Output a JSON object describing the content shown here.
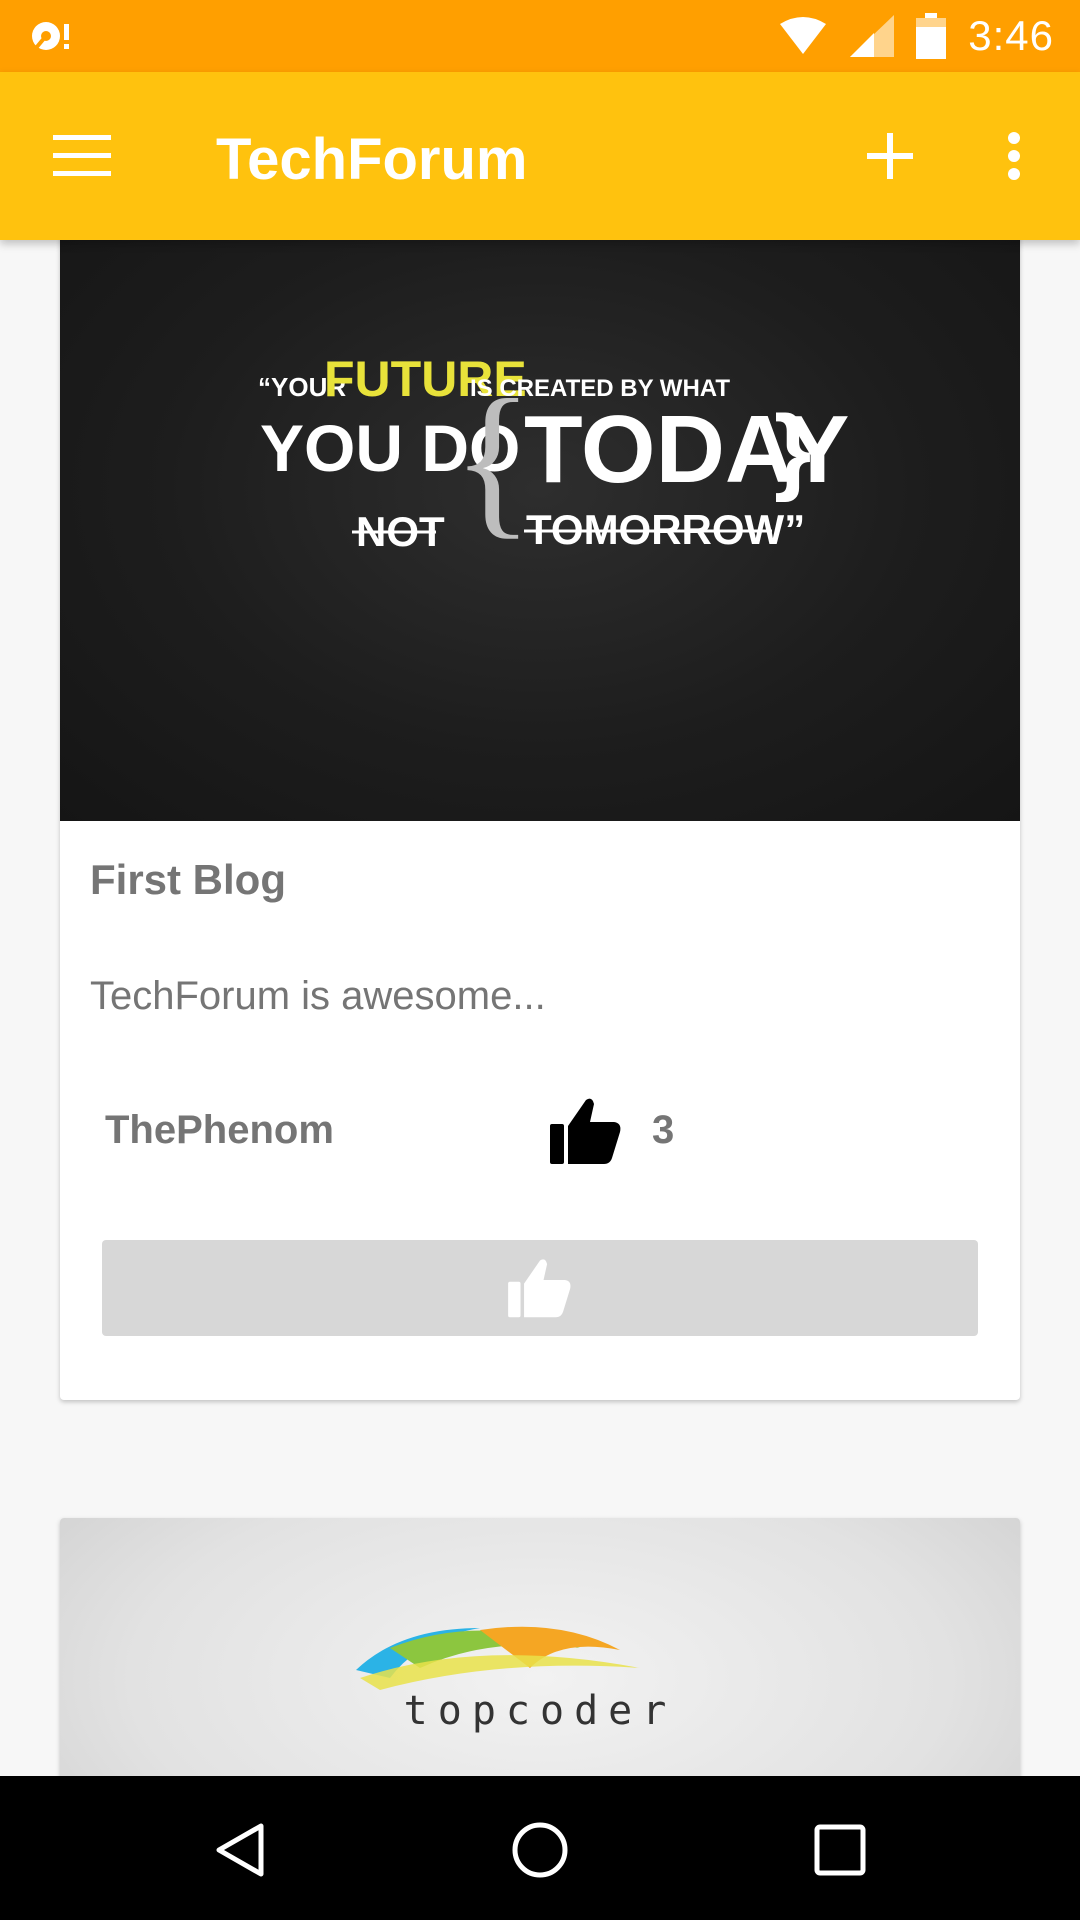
{
  "status_bar": {
    "time": "3:46",
    "icons": [
      "notification-icon",
      "wifi-icon",
      "cell-signal-icon",
      "battery-icon"
    ]
  },
  "app_bar": {
    "title": "TechForum",
    "icons": [
      "menu-icon",
      "add-icon",
      "more-vert-icon"
    ]
  },
  "posts": [
    {
      "image_text": {
        "line1_a": "“YOUR",
        "line1_b": "FUTURE",
        "line1_c": "IS CREATED BY WHAT",
        "line2_a": "YOU DO",
        "line2_b": "TODAY",
        "line3_a": "NOT",
        "line3_b": "TOMORROW”"
      },
      "title": "First Blog",
      "body": "TechForum is awesome...",
      "author": "ThePhenom",
      "like_count": "3"
    },
    {
      "image_text": {
        "logo_text": "topcoder"
      }
    }
  ],
  "colors": {
    "status_bar": "#ff9f00",
    "app_bar": "#ffc20e",
    "quote_accent": "#e8e23a",
    "text_gray": "#757575",
    "like_button_bg": "#d7d7d7"
  },
  "nav_bar": {
    "icons": [
      "back-icon",
      "home-icon",
      "recents-icon"
    ]
  }
}
